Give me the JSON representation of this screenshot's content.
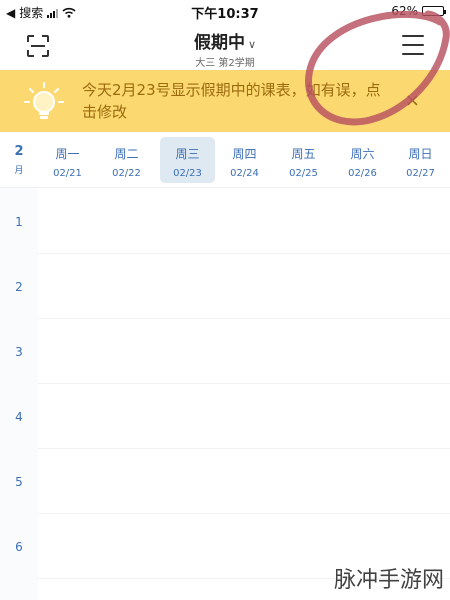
{
  "status_bar": {
    "carrier": "搜索",
    "time": "下午10:37",
    "battery": "62%",
    "battery_level": 0.62
  },
  "header": {
    "title": "假期中",
    "subtitle": "大三 第2学期",
    "icons": [
      "scan-icon",
      "menu-icon",
      "chevron-down-icon"
    ]
  },
  "banner": {
    "text": "今天2月23号显示假期中的课表，如有误，点击修改",
    "close": "×",
    "bg_color": "#fcd970",
    "text_color": "#9b6a0f"
  },
  "week": {
    "month_num": "2",
    "month_unit": "月",
    "days": [
      {
        "name": "周一",
        "date": "02/21"
      },
      {
        "name": "周二",
        "date": "02/22"
      },
      {
        "name": "周三",
        "date": "02/23"
      },
      {
        "name": "周四",
        "date": "02/24"
      },
      {
        "name": "周五",
        "date": "02/25"
      },
      {
        "name": "周六",
        "date": "02/26"
      },
      {
        "name": "周日",
        "date": "02/27"
      }
    ],
    "today_index": 2
  },
  "periods": [
    "1",
    "2",
    "3",
    "4",
    "5",
    "6"
  ],
  "accent_color": "#3b6fb6",
  "watermark": "脉冲手游网"
}
